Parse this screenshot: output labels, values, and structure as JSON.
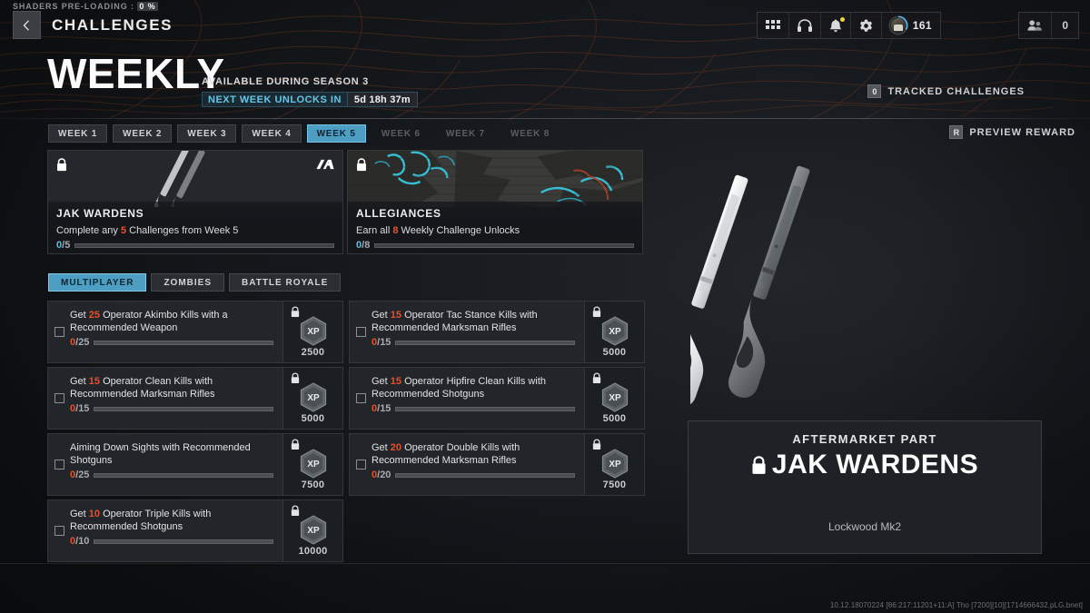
{
  "shaders": {
    "label": "SHADERS PRE-LOADING :",
    "percent": "0 %"
  },
  "topbar": {
    "title": "CHALLENGES",
    "back_icon": "chevron-left-icon",
    "hud_left": [
      {
        "icon": "grid-apps-icon",
        "name": "apps"
      },
      {
        "icon": "headphones-icon",
        "name": "audio"
      },
      {
        "icon": "bell-icon",
        "name": "notifications",
        "badge": true
      },
      {
        "icon": "gear-icon",
        "name": "settings"
      }
    ],
    "level": {
      "icon": "player-avatar-icon",
      "value": "161"
    },
    "squad": {
      "icon": "squad-icon",
      "value": "0"
    }
  },
  "hero": {
    "title": "WEEKLY",
    "subtitle": "AVAILABLE DURING SEASON 3",
    "timer_label": "NEXT WEEK UNLOCKS IN",
    "timer_value": "5d 18h 37m",
    "tracked_key": "0",
    "tracked_label": "TRACKED CHALLENGES"
  },
  "preview_reward": {
    "key": "R",
    "label": "PREVIEW REWARD"
  },
  "weeks": [
    {
      "label": "WEEK 1",
      "state": "available"
    },
    {
      "label": "WEEK 2",
      "state": "available"
    },
    {
      "label": "WEEK 3",
      "state": "available"
    },
    {
      "label": "WEEK 4",
      "state": "available"
    },
    {
      "label": "WEEK 5",
      "state": "active"
    },
    {
      "label": "WEEK 6",
      "state": "locked"
    },
    {
      "label": "WEEK 7",
      "state": "locked"
    },
    {
      "label": "WEEK 8",
      "state": "locked"
    }
  ],
  "rewards": [
    {
      "name": "JAK WARDENS",
      "description_pre": "Complete any ",
      "description_num": "5",
      "description_post": " Challenges from Week 5",
      "current": "0",
      "total": "5",
      "progress_pct": 0,
      "locked": true,
      "badge": "aftermarket-part-logo"
    },
    {
      "name": "ALLEGIANCES",
      "description_pre": "Earn all ",
      "description_num": "8",
      "description_post": " Weekly Challenge Unlocks",
      "current": "0",
      "total": "8",
      "progress_pct": 0,
      "locked": true,
      "badge": ""
    }
  ],
  "modes": [
    {
      "label": "MULTIPLAYER",
      "active": true
    },
    {
      "label": "ZOMBIES",
      "active": false
    },
    {
      "label": "BATTLE ROYALE",
      "active": false
    }
  ],
  "challenges": [
    {
      "pre": "Get ",
      "num": "25",
      "post": " Operator Akimbo Kills with a Recommended Weapon",
      "current": "0",
      "total": "25",
      "progress_pct": 0,
      "xp": "2500",
      "locked": true
    },
    {
      "pre": "Get ",
      "num": "15",
      "post": " Operator Tac Stance Kills with Recommended Marksman Rifles",
      "current": "0",
      "total": "15",
      "progress_pct": 0,
      "xp": "5000",
      "locked": true
    },
    {
      "pre": "Get ",
      "num": "15",
      "post": " Operator Clean Kills with Recommended Marksman Rifles",
      "current": "0",
      "total": "15",
      "progress_pct": 0,
      "xp": "5000",
      "locked": true
    },
    {
      "pre": "Get ",
      "num": "15",
      "post": " Operator Hipfire Clean Kills with Recommended Shotguns",
      "current": "0",
      "total": "15",
      "progress_pct": 0,
      "xp": "5000",
      "locked": true
    },
    {
      "pre": "",
      "num": "",
      "post": "Aiming Down Sights with Recommended Shotguns",
      "current": "0",
      "total": "25",
      "progress_pct": 0,
      "xp": "7500",
      "locked": true
    },
    {
      "pre": "Get ",
      "num": "20",
      "post": " Operator Double Kills with Recommended Marksman Rifles",
      "current": "0",
      "total": "20",
      "progress_pct": 0,
      "xp": "7500",
      "locked": true
    },
    {
      "pre": "Get ",
      "num": "10",
      "post": " Operator Triple Kills with Recommended Shotguns",
      "current": "0",
      "total": "10",
      "progress_pct": 0,
      "xp": "10000",
      "locked": true
    }
  ],
  "info_panel": {
    "kicker": "AFTERMARKET PART",
    "title": "JAK WARDENS",
    "weapon": "Lockwood Mk2",
    "locked": true
  },
  "footer": {
    "build": "10.12.18070224 [86:217:11201+11:A] Tho [7200][10][1714666432.pLG.bnet]"
  },
  "colors": {
    "accent_blue": "#4e9ec4",
    "accent_cyan": "#5ec0e0",
    "accent_orange": "#e8502a",
    "panel_bg": "#222529",
    "panel_border": "#33363b"
  }
}
